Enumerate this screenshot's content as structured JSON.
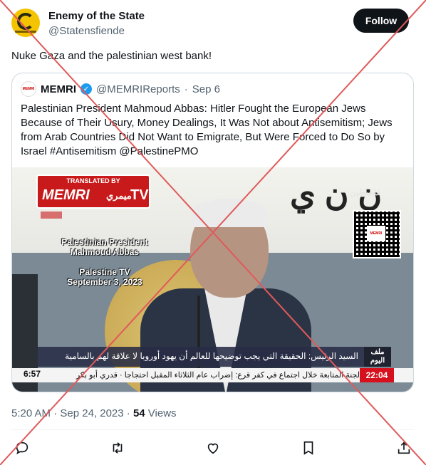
{
  "author": {
    "name": "Enemy of the State",
    "handle": "@Statensfiende",
    "follow_label": "Follow"
  },
  "tweet": {
    "text": "Nuke Gaza and the palestinian west bank!",
    "date": "5:20 AM · Sep 24, 2023 · ",
    "views_count": "54",
    "views_label": " Views"
  },
  "quoted": {
    "logo_text": "MEMRI",
    "name": "MEMRI",
    "handle": "@MEMRIReports",
    "separator": " · ",
    "date": "Sep 6",
    "text": "Palestinian President Mahmoud Abbas: Hitler Fought the European Jews Because of Their Usury, Money Dealings, It Was Not about Antisemitism; Jews from Arab Countries Did Not Want to Emigrate, But Were Forced to Do So by Israel #Antisemitism @PalestinePMO"
  },
  "media": {
    "translated_by": "TRANSLATED BY",
    "memri": "MEMRI",
    "memri_arabic": "ميمري",
    "tv": "TV",
    "caption_name": "Palestinian President Mahmoud Abbas",
    "caption_channel": "Palestine TV",
    "caption_date": "September 3, 2023",
    "channel_logo": "فلسطين",
    "qr_label": "MEMRI",
    "ticker_label": "ملف اليوم",
    "ticker_main": "السيد الرئيس: الحقيقة التي يجب توضيحها للعالم أن يهود أوروبا لا علاقة لهم بالسامية",
    "ticker_bottom": "لجنة المتابعة خلال اجتماع في كفر قرع: إضراب عام الثلاثاء المقبل احتجاجا    ·    قدري أبو بكر",
    "time_left": "6:57",
    "time_right": "22:04"
  },
  "colors": {
    "text": "#0f1419",
    "secondary": "#536471",
    "border": "#cfd9de",
    "verified": "#1d9bf0",
    "overlay_cross": "#e05a5a"
  },
  "icons": [
    "reply-icon",
    "retweet-icon",
    "like-icon",
    "bookmark-icon",
    "share-icon"
  ]
}
